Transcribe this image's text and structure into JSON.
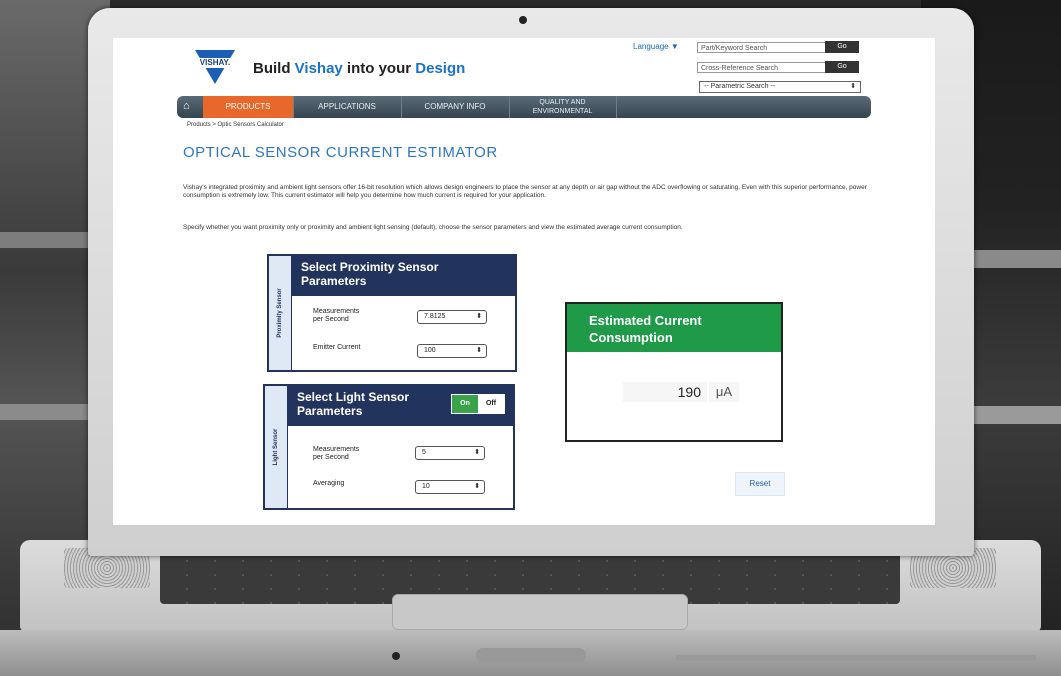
{
  "header": {
    "logo_text": "VISHAY.",
    "tagline_prefix": "Build ",
    "tagline_brand": "Vishay",
    "tagline_middle": " into your ",
    "tagline_end": "Design",
    "language_label": "Language ▼",
    "part_search_placeholder": "Part/Keyword Search",
    "cross_ref_placeholder": "Cross-Reference Search",
    "go_label": "Go",
    "parametric_select": "-- Parametric Search --"
  },
  "nav": {
    "items": [
      {
        "label": "PRODUCTS"
      },
      {
        "label": "APPLICATIONS"
      },
      {
        "label": "COMPANY INFO"
      },
      {
        "label": "QUALITY AND ENVIRONMENTAL"
      }
    ]
  },
  "breadcrumb": "Products > Optic Sensors Calculator",
  "page": {
    "title": "OPTICAL SENSOR CURRENT ESTIMATOR",
    "intro": "Vishay's integrated proximity and ambient light sensors offer 16-bit resolution which allows design engineers to place the sensor at any depth or air gap without the ADC overflowing or saturating. Even with this superior performance, power consumption is extremely low. This current estimator will help you determine how much current is required for your application.",
    "instructions": "Specify whether you want proximity only or proximity and ambient light sensing (default), choose the sensor parameters and view the estimated average current consumption."
  },
  "proximity": {
    "side_label": "Proximity Sensor",
    "title_line1": "Select Proximity Sensor",
    "title_line2": "Parameters",
    "measurements_label_1": "Measurements",
    "measurements_label_2": "per Second",
    "measurements_value": "7.8125",
    "emitter_label": "Emitter Current",
    "emitter_value": "100"
  },
  "light": {
    "side_label": "Light Sensor",
    "title_line1": "Select Light Sensor",
    "title_line2": "Parameters",
    "toggle_on": "On",
    "toggle_off": "Off",
    "measurements_label_1": "Measurements",
    "measurements_label_2": "per Second",
    "measurements_value": "5",
    "averaging_label": "Averaging",
    "averaging_value": "10"
  },
  "result": {
    "title_line1": "Estimated Current",
    "title_line2": "Consumption",
    "value": "190",
    "unit": "μA"
  },
  "reset_label": "Reset",
  "colors": {
    "nav_active": "#e8672a",
    "panel_blue": "#22345e",
    "result_green": "#1e9a48",
    "title_blue": "#2e75c8"
  }
}
